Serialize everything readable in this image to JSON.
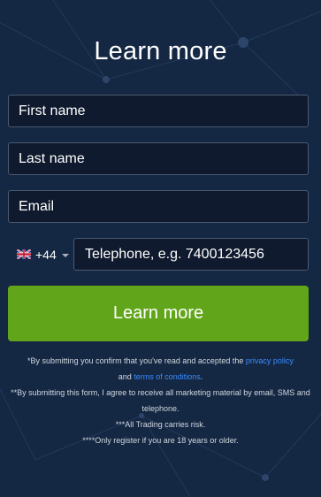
{
  "form": {
    "title": "Learn more",
    "first_name_placeholder": "First name",
    "last_name_placeholder": "Last name",
    "email_placeholder": "Email",
    "phone": {
      "country_flag": "uk-flag-icon",
      "country_code": "+44",
      "placeholder": "Telephone, e.g. 7400123456"
    },
    "submit_label": "Learn more"
  },
  "disclaimer": {
    "line1_prefix": "*By submitting you confirm that you've read and accepted the ",
    "privacy_link": "privacy policy",
    "line1_and": "and ",
    "terms_link": "terms of conditions",
    "line1_suffix": ".",
    "line2": "**By submitting this form, I agree to receive all marketing material by email, SMS and telephone.",
    "line3": "***All Trading carries risk.",
    "line4": "****Only register if you are 18 years or older."
  },
  "colors": {
    "background": "#142743",
    "field_background": "#0f1a2e",
    "button": "#61a61a",
    "link": "#3b8dff"
  }
}
